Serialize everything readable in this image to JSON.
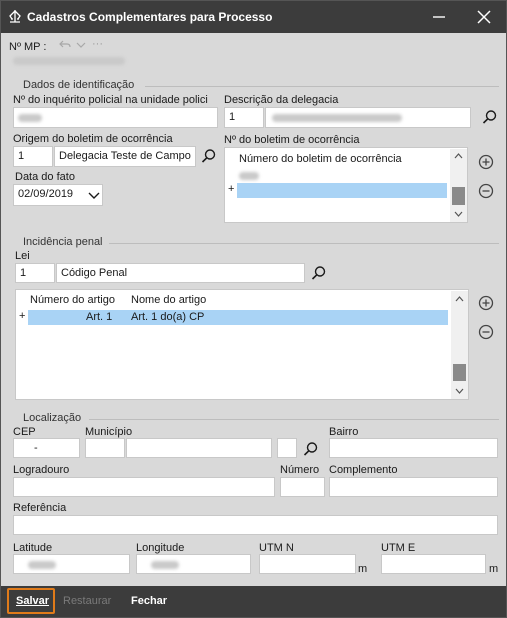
{
  "window": {
    "title": "Cadastros Complementares para Processo"
  },
  "header": {
    "mp_label": "Nº MP :",
    "undo_icon": "undo-icon",
    "redo_icon": "chevron-down-icon",
    "more_icon": "more-icon",
    "more_text": "···"
  },
  "dados": {
    "group_label": "Dados de identificação",
    "inquerito_label": "Nº do inquérito policial na unidade polici",
    "descricao_label": "Descrição da delegacia",
    "descricao_code": "1",
    "origem_label": "Origem do boletim de ocorrência",
    "origem_code": "1",
    "origem_name": "Delegacia Teste de Campo",
    "boletim_label": "Nº do boletim de ocorrência",
    "boletim_column": "Número do boletim de ocorrência",
    "boletim_new_row_marker": "+",
    "data_label": "Data do fato",
    "data_value": "02/09/2019"
  },
  "incidencia": {
    "group_label": "Incidência penal",
    "lei_label": "Lei",
    "lei_code": "1",
    "lei_name": "Código Penal",
    "columns": [
      "Número do artigo",
      "Nome do artigo"
    ],
    "rows": [
      {
        "marker": "+",
        "numero": "Art. 1",
        "nome": "Art. 1  do(a) CP"
      }
    ]
  },
  "localizacao": {
    "group_label": "Localização",
    "cep_label": "CEP",
    "cep_value": "-",
    "municipio_label": "Município",
    "bairro_label": "Bairro",
    "logradouro_label": "Logradouro",
    "numero_label": "Número",
    "complemento_label": "Complemento",
    "referencia_label": "Referência",
    "latitude_label": "Latitude",
    "longitude_label": "Longitude",
    "utmn_label": "UTM N",
    "utme_label": "UTM E",
    "utm_unit": "m"
  },
  "footer": {
    "save": "Salvar",
    "restore": "Restaurar",
    "close": "Fechar"
  },
  "colors": {
    "titlebar": "#3c3c3c",
    "selection": "#a9d3f5",
    "focus": "#e07b1a",
    "form_bg": "#d9d9d9"
  }
}
